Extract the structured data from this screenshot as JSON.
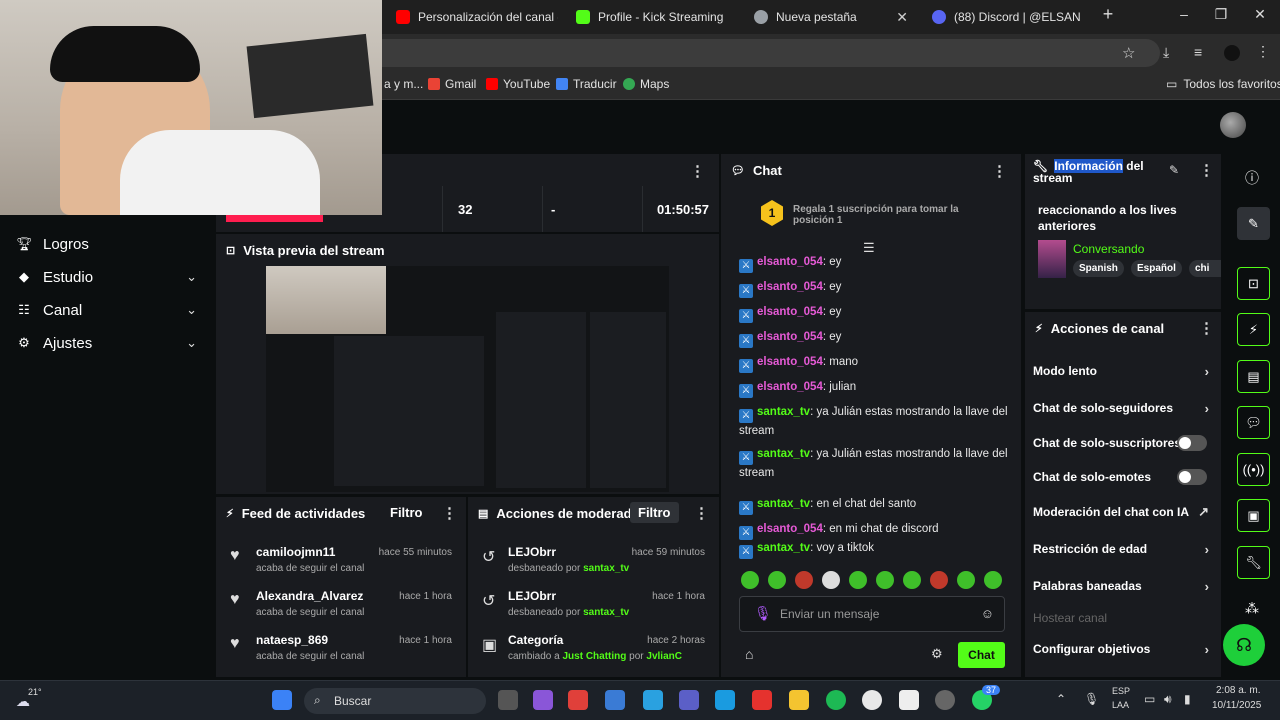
{
  "browser": {
    "tabs": [
      {
        "title": "Personalización del canal -",
        "color": "#ff0000"
      },
      {
        "title": "Profile - Kick Streaming",
        "color": "#53fc18"
      },
      {
        "title": "Nueva pestaña",
        "color": "#9aa0a6"
      },
      {
        "title": "(88) Discord | @ELSAN",
        "color": "#5865f2"
      }
    ],
    "bookmarks": [
      {
        "label": "a y m...",
        "color": "#777"
      },
      {
        "label": "Gmail",
        "color": "#ea4335"
      },
      {
        "label": "YouTube",
        "color": "#ff0000"
      },
      {
        "label": "Traducir",
        "color": "#4285f4"
      },
      {
        "label": "Maps",
        "color": "#34a853"
      }
    ],
    "all_bookmarks": "Todos los favoritos"
  },
  "nav": {
    "items": [
      {
        "label": "Logros",
        "icon": "trophy-icon",
        "chev": false
      },
      {
        "label": "Estudio",
        "icon": "studio-icon",
        "chev": true
      },
      {
        "label": "Canal",
        "icon": "channel-icon",
        "chev": true
      },
      {
        "label": "Ajustes",
        "icon": "gear-icon",
        "chev": true
      }
    ]
  },
  "stats": {
    "followers": "32",
    "subs": "-",
    "duration": "01:50:57"
  },
  "preview": {
    "title": "Vista previa del stream"
  },
  "feed": {
    "title": "Feed de actividades",
    "filter": "Filtro",
    "items": [
      {
        "name": "camiloojmn11",
        "time": "hace 55 minutos",
        "action": "acaba de seguir el canal"
      },
      {
        "name": "Alexandra_Alvarez",
        "time": "hace 1 hora",
        "action": "acaba de seguir el canal"
      },
      {
        "name": "nataesp_869",
        "time": "hace 1 hora",
        "action": "acaba de seguir el canal"
      }
    ]
  },
  "mod": {
    "title": "Acciones de moderador",
    "filter": "Filtro",
    "items": [
      {
        "name": "LEJObrr",
        "time": "hace 59 minutos",
        "pre": "desbaneado por",
        "who": "santax_tv",
        "post": "",
        "who2": ""
      },
      {
        "name": "LEJObrr",
        "time": "hace 1 hora",
        "pre": "desbaneado por",
        "who": "santax_tv",
        "post": "",
        "who2": ""
      },
      {
        "name": "Categoría",
        "time": "hace 2 horas",
        "pre": "cambiado a",
        "who": "Just Chatting",
        "post": "por",
        "who2": "JvlianC"
      }
    ]
  },
  "chat": {
    "title": "Chat",
    "banner": "Regala 1 suscripción para tomar la posición 1",
    "rank": "1",
    "messages": [
      {
        "user": "elsanto_054",
        "text": "ey",
        "c": "u1"
      },
      {
        "user": "elsanto_054",
        "text": "ey",
        "c": "u1"
      },
      {
        "user": "elsanto_054",
        "text": "ey",
        "c": "u1"
      },
      {
        "user": "elsanto_054",
        "text": "ey",
        "c": "u1"
      },
      {
        "user": "elsanto_054",
        "text": "mano",
        "c": "u1"
      },
      {
        "user": "elsanto_054",
        "text": "julian",
        "c": "u1"
      },
      {
        "user": "santax_tv",
        "text": "ya Julián estas mostrando la llave del stream",
        "c": "u2"
      },
      {
        "user": "santax_tv",
        "text": "ya Julián estas mostrando la llave del stream",
        "c": "u2"
      },
      {
        "user": "santax_tv",
        "text": "en el chat del santo",
        "c": "u2"
      },
      {
        "user": "elsanto_054",
        "text": "en mi chat de discord",
        "c": "u1"
      },
      {
        "user": "santax_tv",
        "text": "voy a tiktok",
        "c": "u2"
      }
    ],
    "input_placeholder": "Enviar un mensaje",
    "send": "Chat"
  },
  "info": {
    "title_highlight": "Información",
    "title_rest": "del stream",
    "stream_title": "reaccionando a los lives anteriores",
    "category": "Conversando",
    "tags": [
      "Spanish",
      "Español",
      "chi"
    ]
  },
  "actions": {
    "title": "Acciones de canal",
    "items": [
      {
        "label": "Modo lento",
        "type": "chevron"
      },
      {
        "label": "Chat de solo-seguidores",
        "type": "chevron"
      },
      {
        "label": "Chat de solo-suscriptores",
        "type": "toggle"
      },
      {
        "label": "Chat de solo-emotes",
        "type": "toggle"
      },
      {
        "label": "Moderación del chat con IA",
        "type": "external"
      },
      {
        "label": "Restricción de edad",
        "type": "chevron"
      },
      {
        "label": "Palabras baneadas",
        "type": "chevron"
      },
      {
        "label": "Hostear canal",
        "type": "disabled"
      },
      {
        "label": "Configurar objetivos",
        "type": "chevron"
      }
    ]
  },
  "taskbar": {
    "weather": "21°",
    "search": "Buscar",
    "lang1": "ESP",
    "lang2": "LAA",
    "time": "2:08 a. m.",
    "date": "10/11/2025",
    "whatsapp_badge": "37"
  }
}
